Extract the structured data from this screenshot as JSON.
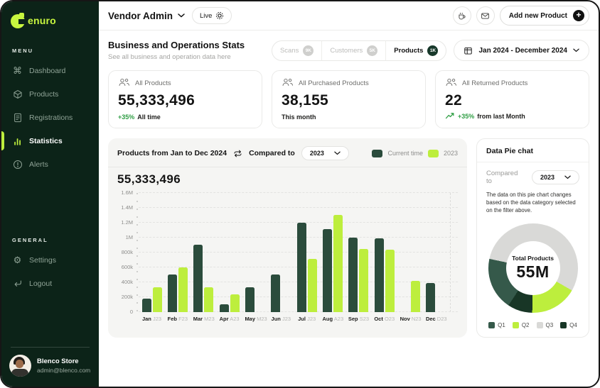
{
  "brand": {
    "name": "enuro"
  },
  "sidebar": {
    "menu_label": "MENU",
    "general_label": "GENERAL",
    "menu": [
      {
        "label": "Dashboard",
        "icon": "dashboard-icon",
        "active": false
      },
      {
        "label": "Products",
        "icon": "products-cube-icon",
        "active": false
      },
      {
        "label": "Registrations",
        "icon": "registrations-document-icon",
        "active": false
      },
      {
        "label": "Statistics",
        "icon": "statistics-bars-icon",
        "active": true
      },
      {
        "label": "Alerts",
        "icon": "alerts-icon",
        "active": false
      }
    ],
    "general": [
      {
        "label": "Settings",
        "icon": "settings-gear-icon"
      },
      {
        "label": "Logout",
        "icon": "logout-icon"
      }
    ],
    "user": {
      "name": "Blenco Store",
      "email": "admin@blenco.com"
    }
  },
  "topbar": {
    "title": "Vendor Admin",
    "live_badge": "Live",
    "add_product_button": "Add new Product"
  },
  "page_header": {
    "title": "Business and Operations Stats",
    "subtitle": "See all business and operation data here",
    "filters": [
      {
        "label": "Scans",
        "badge": "9K",
        "active": false
      },
      {
        "label": "Customers",
        "badge": "5K",
        "active": false
      },
      {
        "label": "Products",
        "badge": "1K",
        "active": true
      }
    ],
    "date_range": "Jan 2024 - December 2024"
  },
  "stat_cards": [
    {
      "label": "All Products",
      "value": "55,333,496",
      "delta": "+35%",
      "footer": "All time",
      "trend": false
    },
    {
      "label": "All Purchased Products",
      "value": "38,155",
      "delta": "",
      "footer": "This month",
      "trend": false
    },
    {
      "label": "All Returned Products",
      "value": "22",
      "delta": "+35%",
      "footer": "from last Month",
      "trend": true
    }
  ],
  "bar_card": {
    "title": "Products from Jan to Dec 2024",
    "compared_to": "Compared to",
    "compare_value": "2023",
    "total": "55,333,496"
  },
  "pie_card": {
    "title": "Data Pie chat",
    "compared_to": "Compared to",
    "compare_value": "2023",
    "description": "The data on this pie chart changes based on the data category selected on the filter above."
  },
  "colors": {
    "accent_lime": "#bdee3d",
    "dark_green": "#2b4c3c",
    "sidebar_bg": "#0c2318",
    "positive_green": "#2f9e44"
  },
  "chart_data": [
    {
      "type": "bar",
      "title": "Products from Jan to Dec 2024",
      "categories": [
        "Jan",
        "Feb",
        "Mar",
        "Apr",
        "May",
        "Jun",
        "Jul",
        "Aug",
        "Sep",
        "Oct",
        "Nov",
        "Dec"
      ],
      "sub_labels": [
        "J23",
        "F23",
        "M23",
        "A23",
        "M23",
        "J23",
        "J23",
        "A23",
        "S23",
        "O23",
        "N23",
        "D23"
      ],
      "series": [
        {
          "name": "Current time",
          "color": "#2b4c3c",
          "values": [
            180000,
            500000,
            900000,
            100000,
            330000,
            500000,
            1200000,
            1110000,
            1000000,
            990000,
            0,
            390000
          ]
        },
        {
          "name": "2023",
          "color": "#bdee3d",
          "values": [
            330000,
            600000,
            330000,
            240000,
            0,
            0,
            710000,
            1300000,
            850000,
            840000,
            420000,
            0
          ]
        }
      ],
      "ylim": [
        0,
        1600000
      ],
      "yticks": [
        "0",
        "200k",
        "400k",
        "600k",
        "800k",
        "1M",
        "1.2M",
        "1.4M",
        "1.6M"
      ],
      "grid": true,
      "legend_position": "top-right"
    },
    {
      "type": "pie",
      "title": "Data Pie chat",
      "center_label": "Total Products",
      "center_value": "55M",
      "slices": [
        {
          "name": "Q1",
          "color": "#35594a",
          "percent": 19
        },
        {
          "name": "Q2",
          "color": "#bdee3d",
          "percent": 17
        },
        {
          "name": "Q3",
          "color": "#d9d9d7",
          "percent": 55
        },
        {
          "name": "Q4",
          "color": "#183626",
          "percent": 9
        }
      ],
      "start_angle": 120,
      "draw_order": [
        1,
        3,
        0,
        2
      ],
      "legend_position": "bottom"
    }
  ]
}
